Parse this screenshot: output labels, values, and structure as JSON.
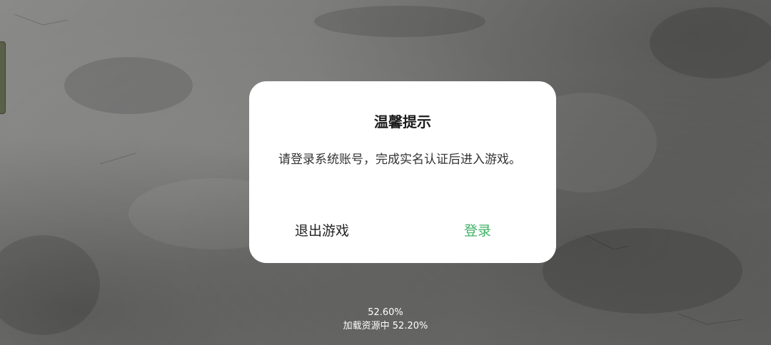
{
  "dialog": {
    "title": "温馨提示",
    "message": "请登录系统账号，完成实名认证后进入游戏。",
    "exit_label": "退出游戏",
    "login_label": "登录"
  },
  "loading": {
    "percent": "52.60%",
    "status": "加载资源中 52.20%"
  },
  "colors": {
    "accent": "#3cb264",
    "dialog_bg": "#ffffff"
  }
}
